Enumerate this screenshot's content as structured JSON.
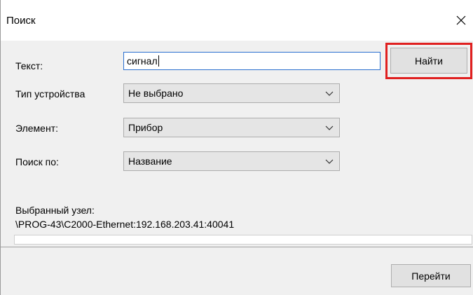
{
  "window": {
    "title": "Поиск"
  },
  "form": {
    "text_label": "Текст:",
    "text_value": "сигнал",
    "device_type_label": "Тип устройства",
    "device_type_value": "Не выбрано",
    "element_label": "Элемент:",
    "element_value": "Прибор",
    "search_by_label": "Поиск по:",
    "search_by_value": "Название"
  },
  "buttons": {
    "find_label": "Найти",
    "go_label": "Перейти"
  },
  "selected_node": {
    "label": "Выбранный узел:",
    "path": "\\PROG-43\\C2000-Ethernet:192.168.203.41:40041"
  },
  "progress": {
    "value": 0
  },
  "colors": {
    "highlight": "#e02020",
    "focus_border": "#2a6fcf"
  },
  "icons": {
    "close": "close-icon",
    "dropdown": "chevron-down-icon"
  }
}
